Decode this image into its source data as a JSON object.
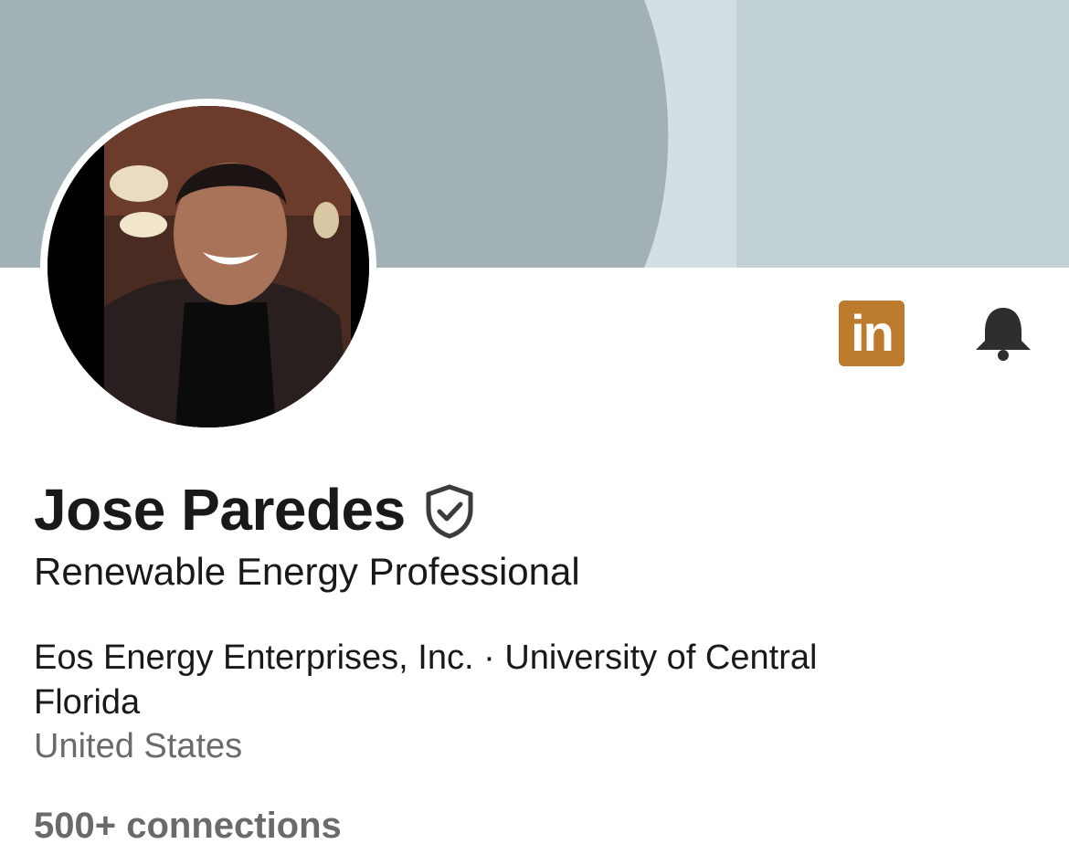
{
  "profile": {
    "name": "Jose Paredes",
    "headline": "Renewable Energy Professional",
    "organizations": "Eos Energy Enterprises, Inc. · University of Central Florida",
    "location": "United States",
    "connections": "500+ connections"
  },
  "badges": {
    "linkedin_label": "in",
    "linkedin_icon": "linkedin-premium-icon",
    "bell_icon": "bell-icon",
    "verified_icon": "verified-shield-icon"
  },
  "colors": {
    "banner_left": "#a2b1b5",
    "banner_mid": "#d4dfe3",
    "banner_right": "#c0d0d5",
    "linkedin_badge": "#bd7b2d",
    "name_text": "#191919",
    "secondary_text": "#6a6a6a"
  }
}
